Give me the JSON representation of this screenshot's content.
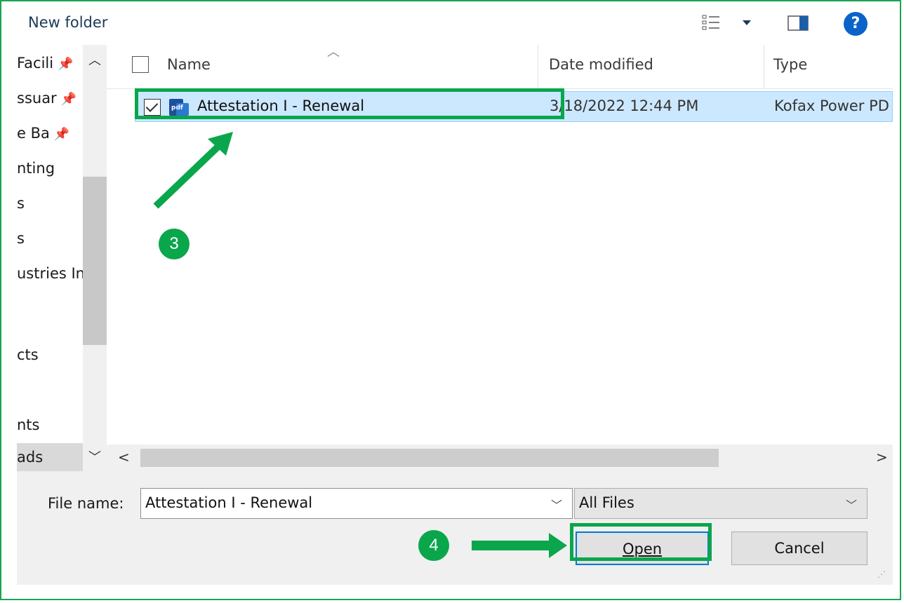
{
  "toolbar": {
    "new_folder_label": "New folder",
    "help_label": "?"
  },
  "nav": {
    "items": [
      {
        "label": "Facili",
        "pinned": true
      },
      {
        "label": "ssuar",
        "pinned": true
      },
      {
        "label": "e Ba",
        "pinned": true
      },
      {
        "label": "nting",
        "pinned": false
      },
      {
        "label": "s",
        "pinned": false
      },
      {
        "label": "s",
        "pinned": false
      },
      {
        "label": "ustries In",
        "pinned": false
      },
      {
        "label": "cts",
        "pinned": false
      },
      {
        "label": "nts",
        "pinned": false
      },
      {
        "label": "ads",
        "pinned": false
      }
    ]
  },
  "columns": {
    "name": "Name",
    "date": "Date modified",
    "type": "Type"
  },
  "files": [
    {
      "name": "Attestation I - Renewal",
      "date": "3/18/2022 12:44 PM",
      "type": "Kofax Power PD",
      "selected": true
    }
  ],
  "bottom": {
    "file_name_label": "File name:",
    "file_name_value": "Attestation I - Renewal",
    "filter_value": "All Files",
    "open_label": "Open",
    "cancel_label": "Cancel"
  },
  "annotations": {
    "step3": "3",
    "step4": "4"
  },
  "colors": {
    "annotation_green": "#0aa64c",
    "selection": "#cce8ff",
    "help_blue": "#0a63c9"
  }
}
